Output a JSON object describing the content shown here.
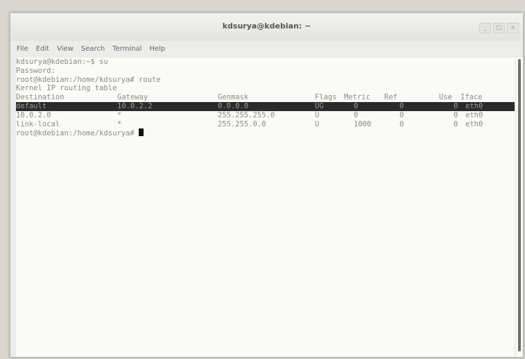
{
  "window": {
    "title": "kdsurya@kdebian: ~",
    "controls": [
      "_",
      "□",
      "×"
    ]
  },
  "menu": [
    "File",
    "Edit",
    "View",
    "Search",
    "Terminal",
    "Help"
  ],
  "terminal": {
    "lines": [
      "kdsurya@kdebian:~$ su",
      "Password:",
      "root@kdebian:/home/kdsurya# route",
      "Kernel IP routing table"
    ],
    "headers": [
      "Destination",
      "Gateway",
      "Genmask",
      "Flags",
      "Metric",
      "Ref",
      "Use",
      "Iface"
    ],
    "rows": [
      [
        "default",
        "10.0.2.2",
        "0.0.0.0",
        "UG",
        "0",
        "0",
        "0",
        "eth0"
      ],
      [
        "10.0.2.0",
        "*",
        "255.255.255.0",
        "U",
        "0",
        "0",
        "0",
        "eth0"
      ],
      [
        "link-local",
        "*",
        "255.255.0.0",
        "U",
        "1000",
        "0",
        "0",
        "eth0"
      ]
    ],
    "prompt": "root@kdebian:/home/kdsurya#"
  }
}
